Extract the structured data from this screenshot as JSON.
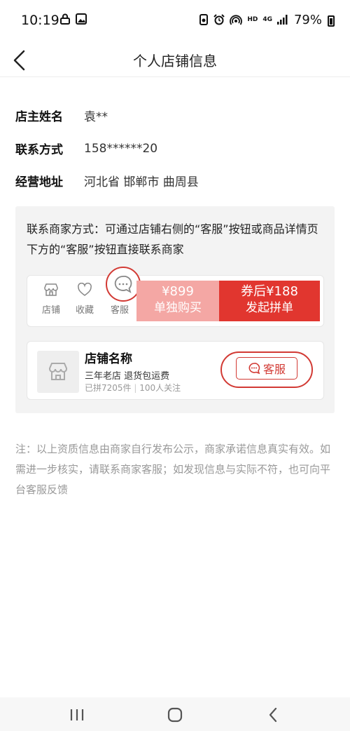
{
  "status_bar": {
    "time": "10:19",
    "network_label": "HD",
    "signal_label": "4G",
    "battery": "79%"
  },
  "header": {
    "title": "个人店铺信息"
  },
  "info": {
    "owner_label": "店主姓名",
    "owner_value": "袁**",
    "contact_label": "联系方式",
    "contact_value": "158******20",
    "address_label": "经营地址",
    "address_value": "河北省 邯郸市 曲周县"
  },
  "contact_box": {
    "text": "联系商家方式：可通过店铺右侧的“客服”按钮或商品详情页下方的“客服”按钮直接联系商家",
    "mock_bar": {
      "shop_label": "店铺",
      "favorite_label": "收藏",
      "service_label": "客服",
      "single_price": "¥899",
      "single_label": "单独购买",
      "group_price": "券后¥188",
      "group_label": "发起拼单"
    },
    "shop_card": {
      "name": "店铺名称",
      "tags": "三年老店  退货包运费",
      "sold": "已拼7205件",
      "followers": "100人关注",
      "service_button": "客服"
    }
  },
  "note": "注：以上资质信息由商家自行发布公示，商家承诺信息真实有效。如需进一步核实，请联系商家客服；如发现信息与实际不符，也可向平台客服反馈",
  "colors": {
    "accent": "#e1362f",
    "accent_light": "#f4a7a4",
    "highlight": "#d23a34"
  }
}
